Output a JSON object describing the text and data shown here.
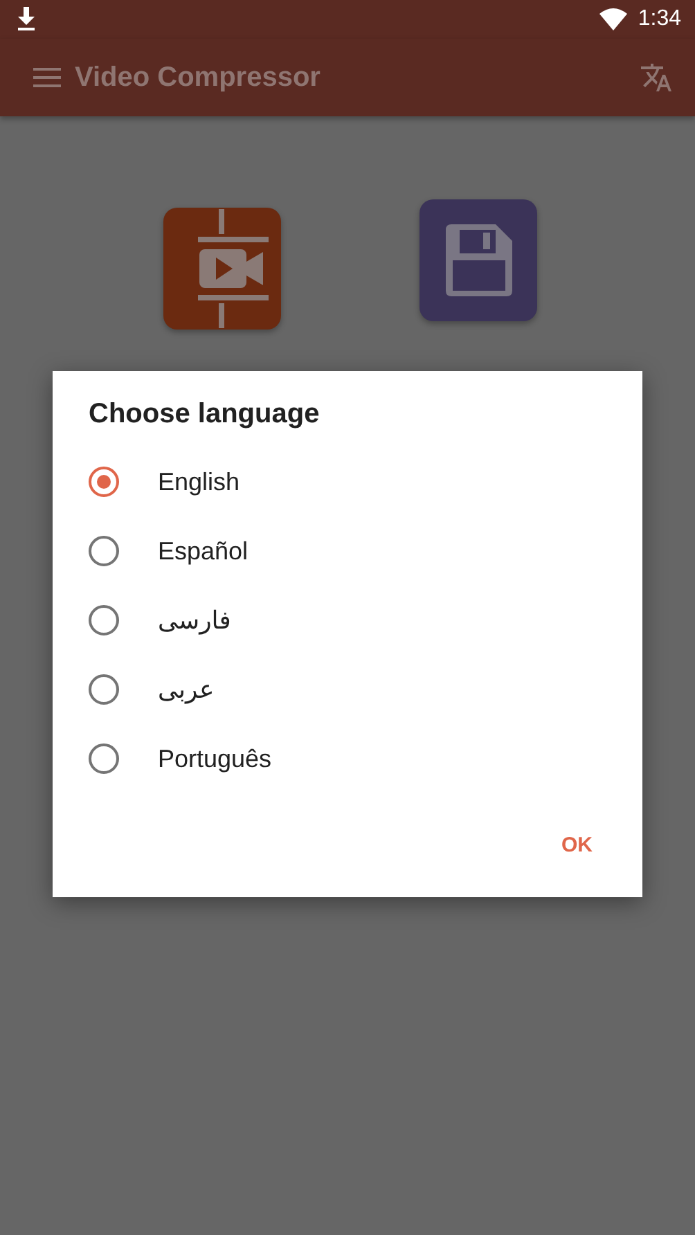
{
  "status_bar": {
    "time": "1:34"
  },
  "app_bar": {
    "title": "Video Compressor"
  },
  "tiles": [
    {
      "kind": "import"
    },
    {
      "kind": "outputs"
    }
  ],
  "dialog": {
    "title": "Choose language",
    "options": [
      {
        "label": "English",
        "selected": true
      },
      {
        "label": "Español",
        "selected": false
      },
      {
        "label": "فارسی",
        "selected": false
      },
      {
        "label": "عربی",
        "selected": false
      },
      {
        "label": "Português",
        "selected": false
      }
    ],
    "button": "OK"
  }
}
